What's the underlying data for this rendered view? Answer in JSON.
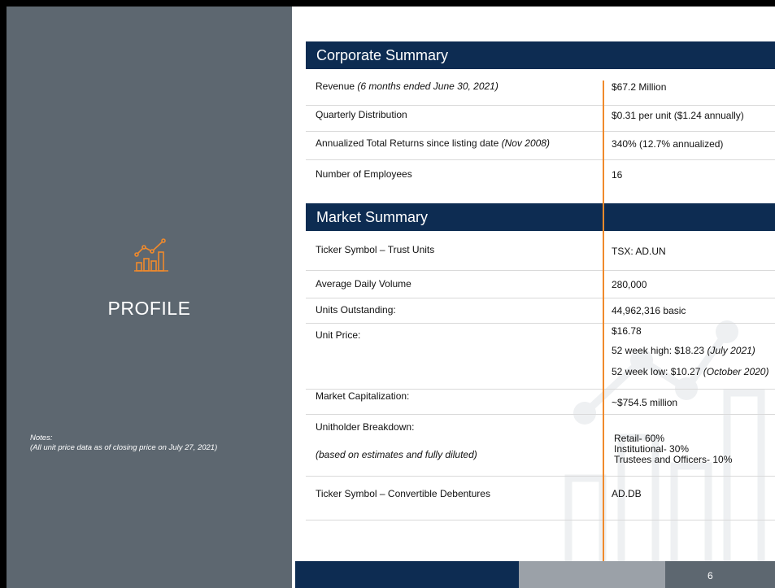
{
  "left_panel": {
    "icon": "chart-growth-icon",
    "title": "PROFILE",
    "notes_title": "Notes:",
    "notes_text": "(All unit price data as of closing price on July 27, 2021)"
  },
  "corporate_summary": {
    "heading": "Corporate Summary",
    "rows": [
      {
        "label": "Revenue",
        "label_note": "(6 months ended June 30, 2021)",
        "value": "$67.2 Million"
      },
      {
        "label": "Quarterly Distribution",
        "label_note": "",
        "value": "$0.31 per unit ($1.24 annually)"
      },
      {
        "label": "Annualized Total Returns since listing date",
        "label_note": "(Nov 2008)",
        "value": "340% (12.7% annualized)"
      },
      {
        "label": "Number of Employees",
        "label_note": "",
        "value": "16"
      }
    ]
  },
  "market_summary": {
    "heading": "Market Summary",
    "ticker": {
      "label": "Ticker Symbol – Trust Units",
      "value": "TSX: AD.UN"
    },
    "volume": {
      "label": "Average Daily Volume",
      "value": "280,000"
    },
    "units": {
      "label": "Units Outstanding:",
      "value": "44,962,316 basic"
    },
    "price": {
      "label": "Unit Price:",
      "value": "$16.78",
      "high": "52 week high: $18.23",
      "high_note": "(July 2021)",
      "low": "52 week low: $10.27",
      "low_note": "(October 2020)"
    },
    "cap": {
      "label": "Market Capitalization:",
      "value": "~$754.5 million"
    },
    "breakdown": {
      "label": "Unitholder Breakdown:",
      "note": "(based on estimates and fully diluted)",
      "values": [
        "Retail- 60%",
        "Institutional- 30%",
        "Trustees and Officers- 10%"
      ]
    },
    "debentures": {
      "label": "Ticker Symbol – Convertible Debentures",
      "value": "AD.DB"
    }
  },
  "footer": {
    "page_number": "6"
  },
  "colors": {
    "navy": "#0d2c52",
    "slate": "#5d6770",
    "accent": "#f08a2c",
    "gray": "#9ba1a8"
  }
}
